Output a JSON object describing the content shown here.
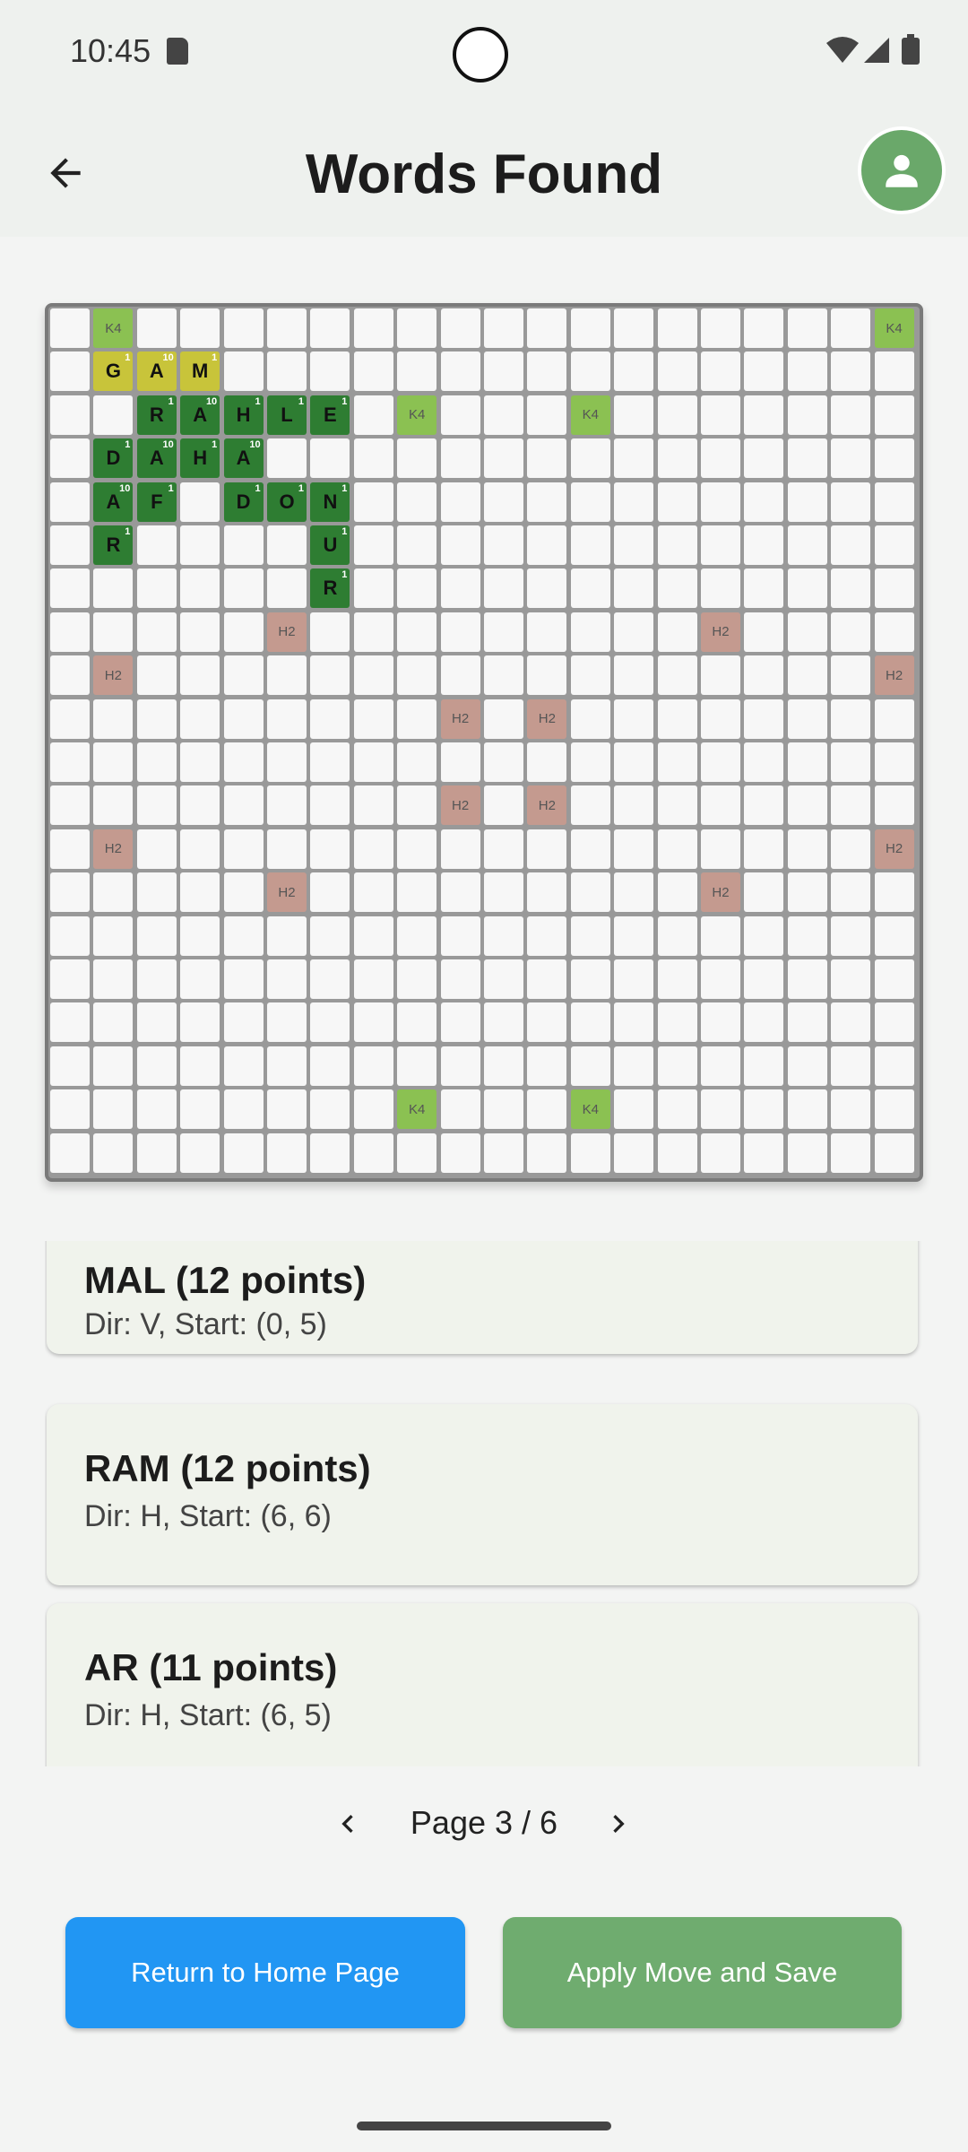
{
  "status_bar": {
    "time": "10:45"
  },
  "app_bar": {
    "title": "Words Found"
  },
  "board": {
    "size": 20,
    "special_cells": [
      {
        "r": 0,
        "c": 1,
        "type": "k4",
        "label": "K4"
      },
      {
        "r": 0,
        "c": 19,
        "type": "k4",
        "label": "K4"
      },
      {
        "r": 2,
        "c": 8,
        "type": "k4",
        "label": "K4"
      },
      {
        "r": 2,
        "c": 12,
        "type": "k4",
        "label": "K4"
      },
      {
        "r": 18,
        "c": 8,
        "type": "k4",
        "label": "K4"
      },
      {
        "r": 18,
        "c": 12,
        "type": "k4",
        "label": "K4"
      },
      {
        "r": 7,
        "c": 5,
        "type": "h2",
        "label": "H2"
      },
      {
        "r": 7,
        "c": 15,
        "type": "h2",
        "label": "H2"
      },
      {
        "r": 8,
        "c": 1,
        "type": "h2",
        "label": "H2"
      },
      {
        "r": 8,
        "c": 19,
        "type": "h2",
        "label": "H2"
      },
      {
        "r": 9,
        "c": 9,
        "type": "h2",
        "label": "H2"
      },
      {
        "r": 9,
        "c": 11,
        "type": "h2",
        "label": "H2"
      },
      {
        "r": 11,
        "c": 9,
        "type": "h2",
        "label": "H2"
      },
      {
        "r": 11,
        "c": 11,
        "type": "h2",
        "label": "H2"
      },
      {
        "r": 12,
        "c": 1,
        "type": "h2",
        "label": "H2"
      },
      {
        "r": 12,
        "c": 19,
        "type": "h2",
        "label": "H2"
      },
      {
        "r": 13,
        "c": 5,
        "type": "h2",
        "label": "H2"
      },
      {
        "r": 13,
        "c": 15,
        "type": "h2",
        "label": "H2"
      }
    ],
    "letter_cells": [
      {
        "r": 1,
        "c": 1,
        "letter": "G",
        "points": "1",
        "type": "pending"
      },
      {
        "r": 1,
        "c": 2,
        "letter": "A",
        "points": "10",
        "type": "pending"
      },
      {
        "r": 1,
        "c": 3,
        "letter": "M",
        "points": "1",
        "type": "pending"
      },
      {
        "r": 2,
        "c": 2,
        "letter": "R",
        "points": "1",
        "type": "word"
      },
      {
        "r": 2,
        "c": 3,
        "letter": "A",
        "points": "10",
        "type": "word"
      },
      {
        "r": 2,
        "c": 4,
        "letter": "H",
        "points": "1",
        "type": "word"
      },
      {
        "r": 2,
        "c": 5,
        "letter": "L",
        "points": "1",
        "type": "word"
      },
      {
        "r": 2,
        "c": 6,
        "letter": "E",
        "points": "1",
        "type": "word"
      },
      {
        "r": 3,
        "c": 1,
        "letter": "D",
        "points": "1",
        "type": "word"
      },
      {
        "r": 3,
        "c": 2,
        "letter": "A",
        "points": "10",
        "type": "word"
      },
      {
        "r": 3,
        "c": 3,
        "letter": "H",
        "points": "1",
        "type": "word"
      },
      {
        "r": 3,
        "c": 4,
        "letter": "A",
        "points": "10",
        "type": "word"
      },
      {
        "r": 4,
        "c": 1,
        "letter": "A",
        "points": "10",
        "type": "word"
      },
      {
        "r": 4,
        "c": 2,
        "letter": "F",
        "points": "1",
        "type": "word"
      },
      {
        "r": 4,
        "c": 4,
        "letter": "D",
        "points": "1",
        "type": "word"
      },
      {
        "r": 4,
        "c": 5,
        "letter": "O",
        "points": "1",
        "type": "word"
      },
      {
        "r": 4,
        "c": 6,
        "letter": "N",
        "points": "1",
        "type": "word"
      },
      {
        "r": 5,
        "c": 1,
        "letter": "R",
        "points": "1",
        "type": "word"
      },
      {
        "r": 5,
        "c": 6,
        "letter": "U",
        "points": "1",
        "type": "word"
      },
      {
        "r": 6,
        "c": 6,
        "letter": "R",
        "points": "1",
        "type": "word"
      }
    ]
  },
  "words": [
    {
      "title": "MAL (12 points)",
      "subtitle": "Dir: V, Start: (0, 5)"
    },
    {
      "title": "RAM (12 points)",
      "subtitle": "Dir: H, Start: (6, 6)"
    },
    {
      "title": "AR (11 points)",
      "subtitle": "Dir: H, Start: (6, 5)"
    }
  ],
  "pagination": {
    "label": "Page 3 / 6"
  },
  "buttons": {
    "home": "Return to Home Page",
    "apply": "Apply Move and Save"
  }
}
